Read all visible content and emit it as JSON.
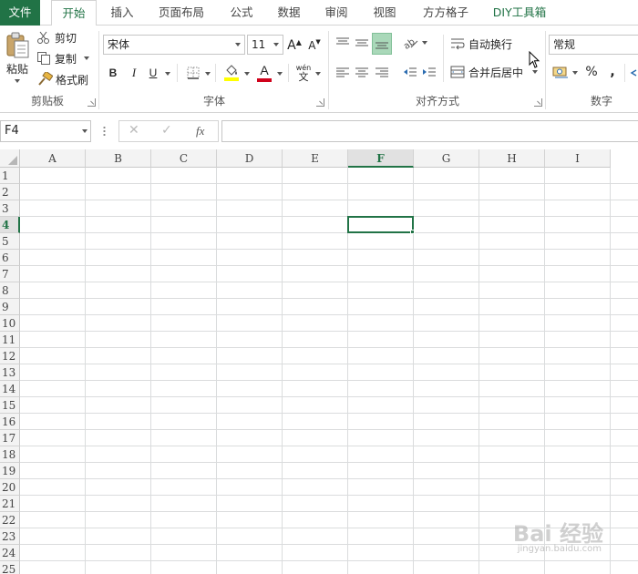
{
  "tabs": {
    "file": "文件",
    "home": "开始",
    "insert": "插入",
    "page_layout": "页面布局",
    "formulas": "公式",
    "data": "数据",
    "review": "审阅",
    "view": "视图",
    "fangfang": "方方格子",
    "diy": "DIY工具箱"
  },
  "clipboard": {
    "paste": "粘贴",
    "cut": "剪切",
    "copy": "复制",
    "format_painter": "格式刷",
    "label": "剪贴板"
  },
  "font": {
    "name": "宋体",
    "size": "11",
    "bold": "B",
    "italic": "I",
    "underline": "U",
    "grow": "A",
    "shrink": "A",
    "wen": "wén",
    "wen_char": "文",
    "font_color_letter": "A",
    "label": "字体",
    "fill_color": "#ffff00",
    "font_color": "#d0021b"
  },
  "alignment": {
    "wrap_text": "自动换行",
    "merge_center": "合并后居中",
    "label": "对齐方式"
  },
  "number": {
    "format": "常规",
    "percent": "%",
    "comma": ",",
    "label": "数字"
  },
  "formula_bar": {
    "name_box": "F4",
    "cancel": "✕",
    "enter": "✓",
    "fx": "fx",
    "value": ""
  },
  "grid": {
    "columns": [
      "A",
      "B",
      "C",
      "D",
      "E",
      "F",
      "G",
      "H",
      "I"
    ],
    "rows": [
      "1",
      "2",
      "3",
      "4",
      "5",
      "6",
      "7",
      "8",
      "9",
      "10",
      "11",
      "12",
      "13",
      "14",
      "15",
      "16",
      "17",
      "18",
      "19",
      "20",
      "21",
      "22",
      "23",
      "24",
      "25"
    ],
    "selected_column": "F",
    "selected_row": "4",
    "accent": "#217346"
  },
  "watermark": {
    "text": "Bai 经验",
    "url": "jingyan.baidu.com"
  }
}
